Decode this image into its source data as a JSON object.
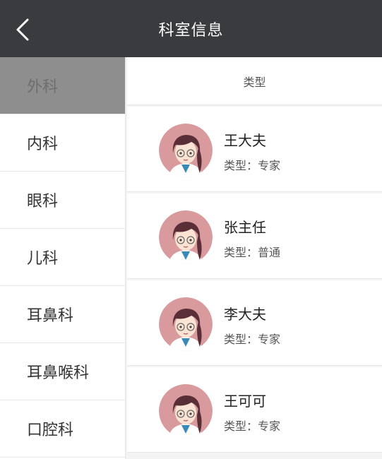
{
  "header": {
    "title": "科室信息",
    "back_icon": "chevron-left-icon"
  },
  "sidebar": {
    "items": [
      {
        "label": "外科",
        "active": true
      },
      {
        "label": "内科",
        "active": false
      },
      {
        "label": "眼科",
        "active": false
      },
      {
        "label": "儿科",
        "active": false
      },
      {
        "label": "耳鼻科",
        "active": false
      },
      {
        "label": "耳鼻喉科",
        "active": false
      },
      {
        "label": "口腔科",
        "active": false
      }
    ]
  },
  "content": {
    "header": "类型",
    "type_prefix": "类型：",
    "doctors": [
      {
        "name": "王大夫",
        "type": "专家"
      },
      {
        "name": "张主任",
        "type": "普通"
      },
      {
        "name": "李大夫",
        "type": "专家"
      },
      {
        "name": "王可可",
        "type": "专家"
      }
    ]
  },
  "colors": {
    "topbar": "#3a3b3f",
    "active_dept_bg": "#8e8e8e",
    "avatar_bg": "#d89a9c"
  }
}
